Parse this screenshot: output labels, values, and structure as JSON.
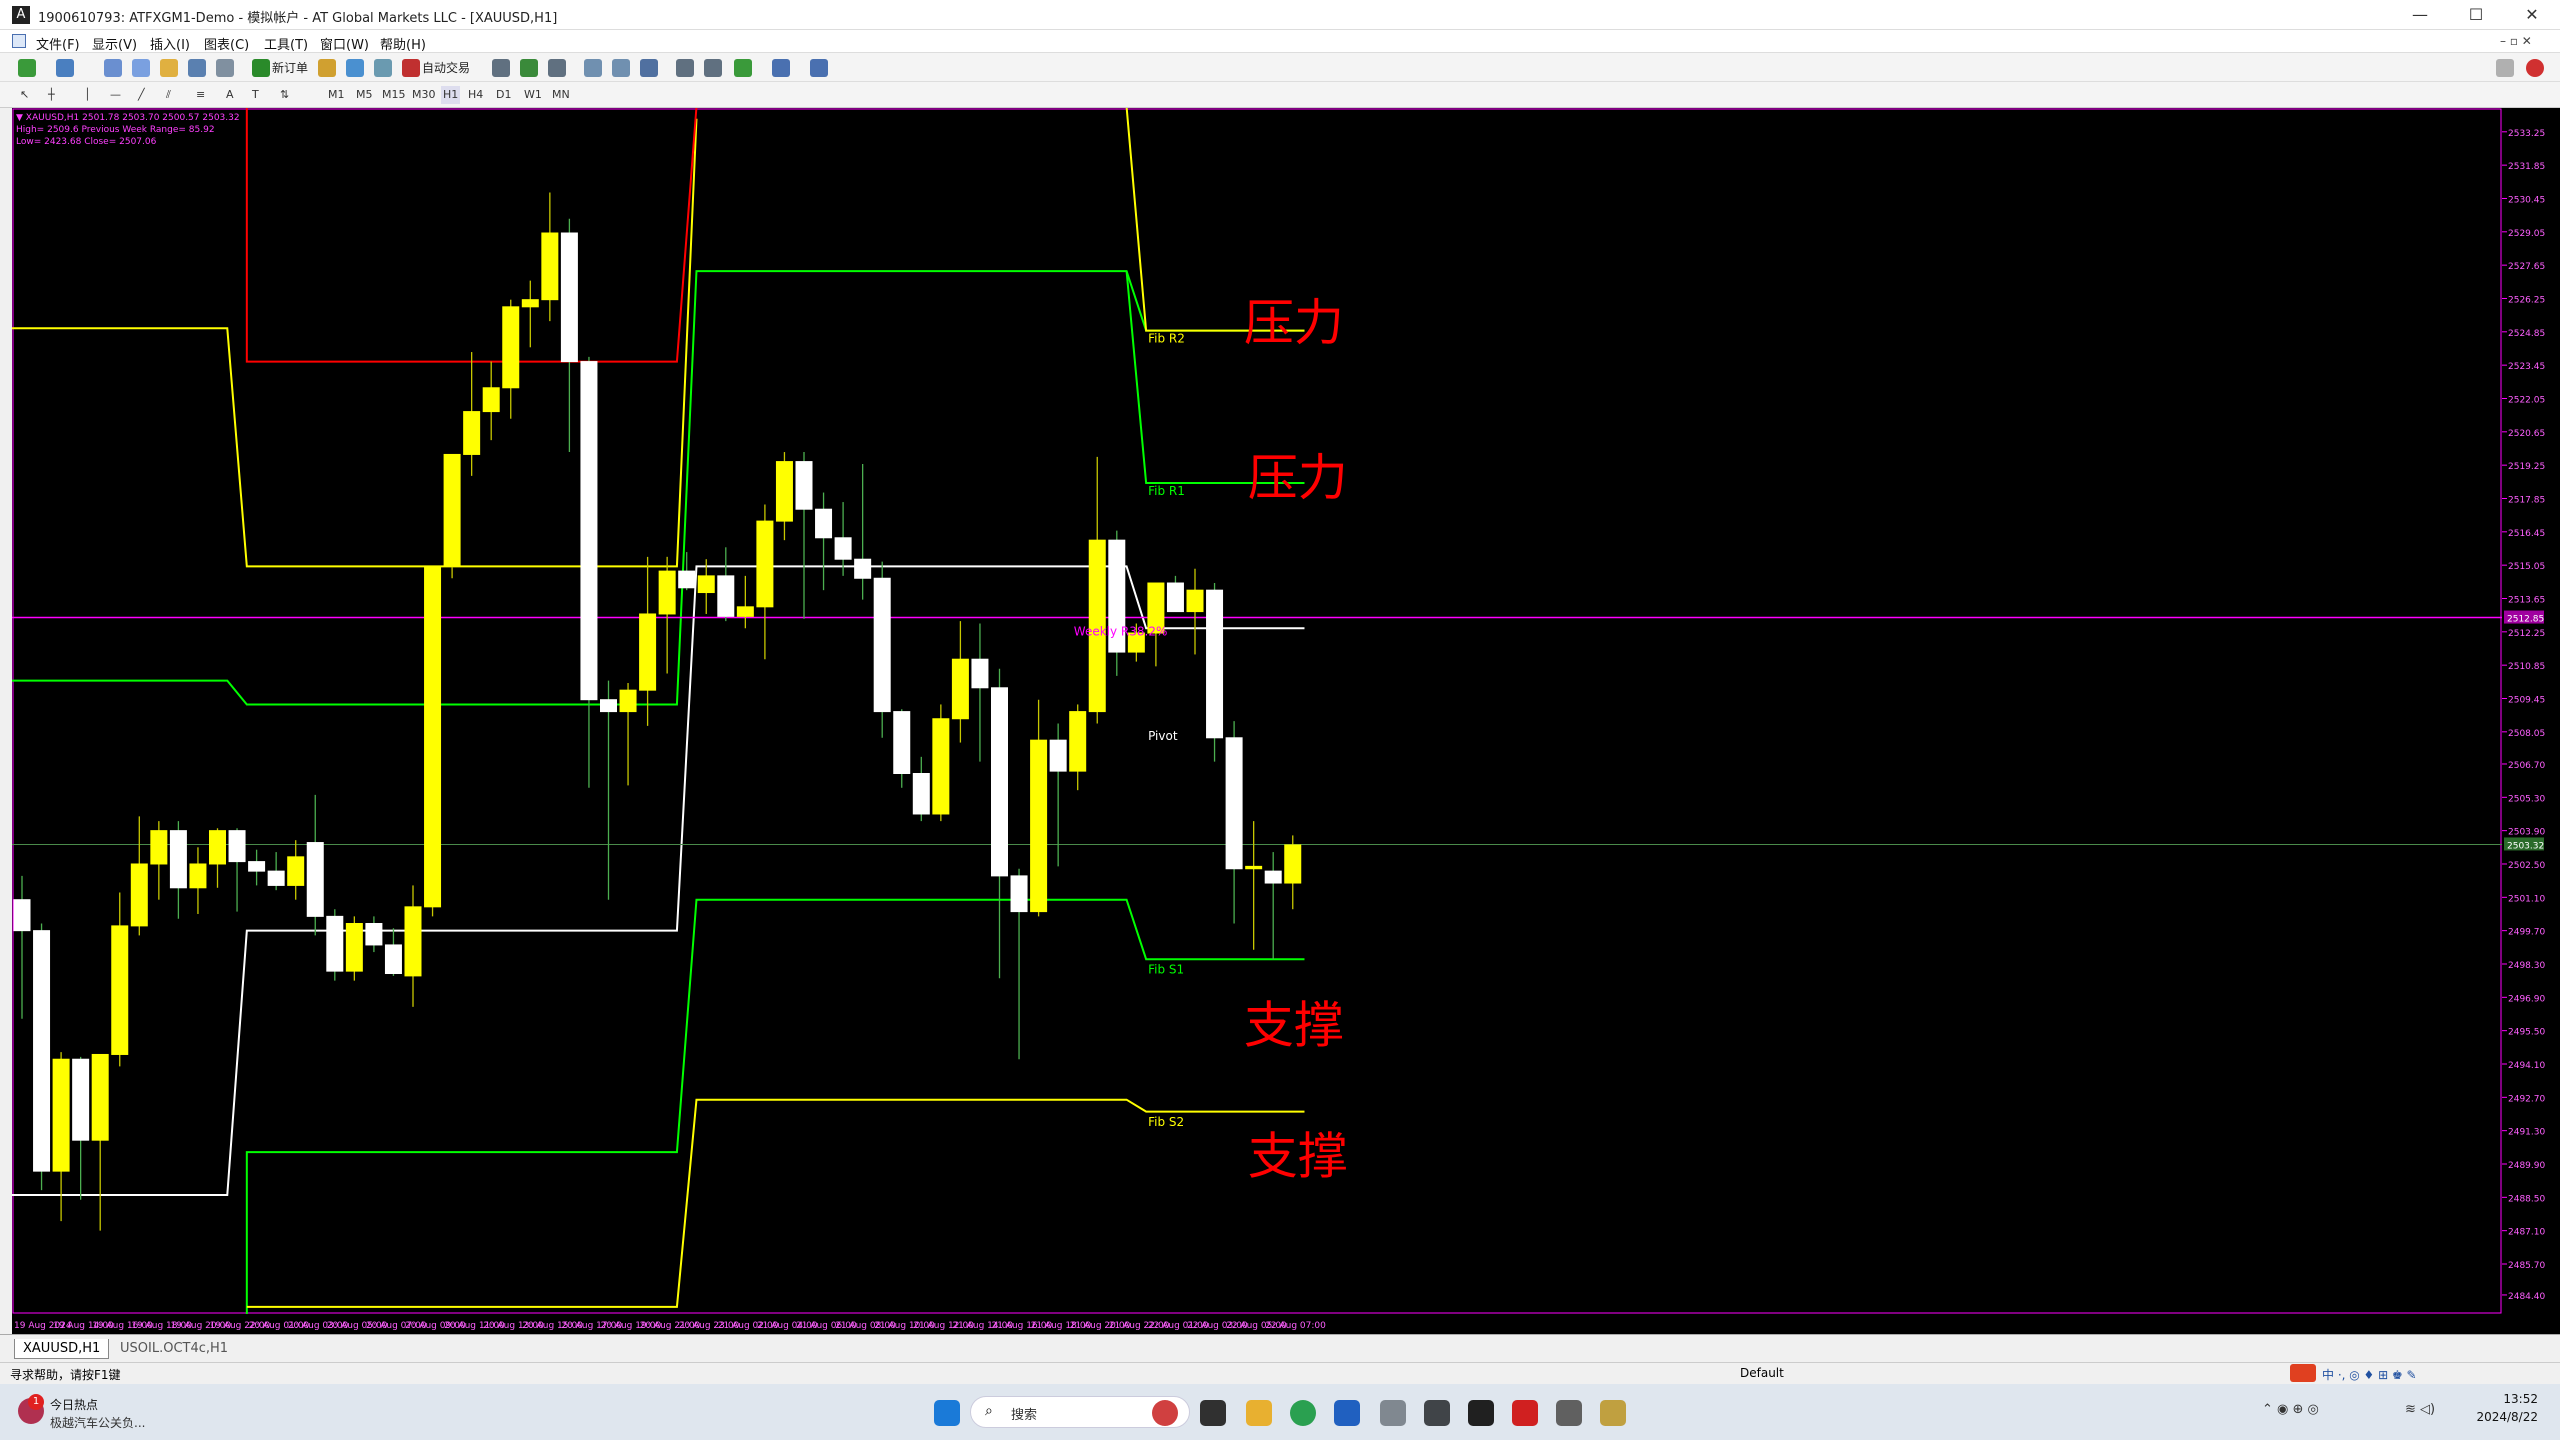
{
  "window": {
    "title": "1900610793: ATFXGM1-Demo - 模拟帐户 - AT Global Markets LLC - [XAUUSD,H1]",
    "app_icon": "A"
  },
  "menu": [
    "文件(F)",
    "显示(V)",
    "插入(I)",
    "图表(C)",
    "工具(T)",
    "窗口(W)",
    "帮助(H)"
  ],
  "toolbar": {
    "new_order": "新订单",
    "auto_trade": "自动交易"
  },
  "timeframes": [
    "M1",
    "M5",
    "M15",
    "M30",
    "H1",
    "H4",
    "D1",
    "W1",
    "MN"
  ],
  "chart": {
    "info_line1": "▼ XAUUSD,H1  2501.78 2503.70 2500.57 2503.32",
    "info_line2": "High= 2509.6    Previous Week Range= 85.92",
    "info_line3": "Low= 2423.68    Close= 2507.06",
    "current_price_label": "2503.32",
    "weekly_line_label": "2512.85",
    "annotations": [
      "压力",
      "压力",
      "支撑",
      "支撑"
    ],
    "level_labels": {
      "fib_r2": "Fib R2",
      "fib_r1": "Fib R1",
      "pivot": "Pivot",
      "fib_s1": "Fib S1",
      "fib_s2": "Fib S2",
      "weekly": "Weekly R38.2%"
    },
    "colors": {
      "bull": "#FFFF00",
      "bear": "#FFFFFF",
      "red_line": "#FF0000",
      "yellow_line": "#FFFF00",
      "green_line": "#00FF00",
      "pivot_line": "#FFFFFF",
      "magenta": "#FF00FF",
      "annotation": "#FF0000"
    }
  },
  "chart_data": {
    "type": "candlestick",
    "symbol": "XAUUSD",
    "timeframe": "H1",
    "y_ticks": [
      "2533.25",
      "2531.85",
      "2530.45",
      "2529.05",
      "2527.65",
      "2526.25",
      "2524.85",
      "2523.45",
      "2522.05",
      "2520.65",
      "2519.25",
      "2517.85",
      "2516.45",
      "2515.05",
      "2513.65",
      "2512.25",
      "2510.85",
      "2509.45",
      "2508.05",
      "2506.70",
      "2505.30",
      "2503.90",
      "2502.50",
      "2501.10",
      "2499.70",
      "2498.30",
      "2496.90",
      "2495.50",
      "2494.10",
      "2492.70",
      "2491.30",
      "2489.90",
      "2488.50",
      "2487.10",
      "2485.70",
      "2484.40"
    ],
    "x_ticks": [
      "19 Aug 2024",
      "19 Aug 14:00",
      "19 Aug 16:00",
      "19 Aug 18:00",
      "19 Aug 20:00",
      "19 Aug 22:00",
      "20 Aug 01:00",
      "20 Aug 03:00",
      "20 Aug 05:00",
      "20 Aug 07:00",
      "20 Aug 09:00",
      "20 Aug 11:00",
      "20 Aug 13:00",
      "20 Aug 15:00",
      "20 Aug 17:00",
      "20 Aug 19:00",
      "20 Aug 21:00",
      "20 Aug 23:00",
      "21 Aug 02:00",
      "21 Aug 04:00",
      "21 Aug 06:00",
      "21 Aug 08:00",
      "21 Aug 10:00",
      "21 Aug 12:00",
      "21 Aug 14:00",
      "21 Aug 16:00",
      "21 Aug 18:00",
      "21 Aug 20:00",
      "21 Aug 22:00",
      "22 Aug 01:00",
      "22 Aug 03:00",
      "22 Aug 05:00",
      "22 Aug 07:00"
    ],
    "candles": [
      {
        "o": 2501.0,
        "h": 2502.0,
        "l": 2496.0,
        "c": 2499.7
      },
      {
        "o": 2499.7,
        "h": 2500.0,
        "l": 2488.8,
        "c": 2489.6
      },
      {
        "o": 2489.6,
        "h": 2494.6,
        "l": 2487.5,
        "c": 2494.3
      },
      {
        "o": 2494.3,
        "h": 2494.4,
        "l": 2488.4,
        "c": 2490.9
      },
      {
        "o": 2490.9,
        "h": 2494.5,
        "l": 2487.1,
        "c": 2494.5
      },
      {
        "o": 2494.5,
        "h": 2501.3,
        "l": 2494.0,
        "c": 2499.9
      },
      {
        "o": 2499.9,
        "h": 2504.5,
        "l": 2499.5,
        "c": 2502.5
      },
      {
        "o": 2502.5,
        "h": 2504.3,
        "l": 2501.0,
        "c": 2503.9
      },
      {
        "o": 2503.9,
        "h": 2504.3,
        "l": 2500.2,
        "c": 2501.5
      },
      {
        "o": 2501.5,
        "h": 2503.2,
        "l": 2500.4,
        "c": 2502.5
      },
      {
        "o": 2502.5,
        "h": 2504.0,
        "l": 2501.5,
        "c": 2503.9
      },
      {
        "o": 2503.9,
        "h": 2504.0,
        "l": 2500.5,
        "c": 2502.6
      },
      {
        "o": 2502.6,
        "h": 2503.1,
        "l": 2501.6,
        "c": 2502.2
      },
      {
        "o": 2502.2,
        "h": 2503.0,
        "l": 2501.4,
        "c": 2501.6
      },
      {
        "o": 2501.6,
        "h": 2503.5,
        "l": 2501.0,
        "c": 2502.8
      },
      {
        "o": 2503.4,
        "h": 2505.4,
        "l": 2499.5,
        "c": 2500.3
      },
      {
        "o": 2500.3,
        "h": 2500.6,
        "l": 2497.6,
        "c": 2498.0
      },
      {
        "o": 2498.0,
        "h": 2500.3,
        "l": 2497.6,
        "c": 2500.0
      },
      {
        "o": 2500.0,
        "h": 2500.3,
        "l": 2498.8,
        "c": 2499.1
      },
      {
        "o": 2499.1,
        "h": 2499.8,
        "l": 2497.8,
        "c": 2497.9
      },
      {
        "o": 2497.8,
        "h": 2501.6,
        "l": 2496.5,
        "c": 2500.7
      },
      {
        "o": 2500.7,
        "h": 2513.0,
        "l": 2500.3,
        "c": 2515.0
      },
      {
        "o": 2515.0,
        "h": 2519.5,
        "l": 2514.5,
        "c": 2519.7
      },
      {
        "o": 2519.7,
        "h": 2524.0,
        "l": 2518.8,
        "c": 2521.5
      },
      {
        "o": 2521.5,
        "h": 2523.6,
        "l": 2520.3,
        "c": 2522.5
      },
      {
        "o": 2522.5,
        "h": 2526.2,
        "l": 2521.2,
        "c": 2525.9
      },
      {
        "o": 2525.9,
        "h": 2527.0,
        "l": 2524.2,
        "c": 2526.2
      },
      {
        "o": 2526.2,
        "h": 2530.7,
        "l": 2525.3,
        "c": 2529.0
      },
      {
        "o": 2529.0,
        "h": 2529.6,
        "l": 2519.8,
        "c": 2523.6
      },
      {
        "o": 2523.6,
        "h": 2523.8,
        "l": 2505.7,
        "c": 2509.4
      },
      {
        "o": 2509.4,
        "h": 2510.2,
        "l": 2501.0,
        "c": 2508.9
      },
      {
        "o": 2508.9,
        "h": 2510.1,
        "l": 2505.8,
        "c": 2509.8
      },
      {
        "o": 2509.8,
        "h": 2515.4,
        "l": 2508.3,
        "c": 2513.0
      },
      {
        "o": 2513.0,
        "h": 2515.4,
        "l": 2510.5,
        "c": 2514.8
      },
      {
        "o": 2514.8,
        "h": 2515.6,
        "l": 2514.0,
        "c": 2514.1
      },
      {
        "o": 2513.9,
        "h": 2515.3,
        "l": 2513.0,
        "c": 2514.6
      },
      {
        "o": 2514.6,
        "h": 2515.8,
        "l": 2512.7,
        "c": 2512.9
      },
      {
        "o": 2512.9,
        "h": 2514.6,
        "l": 2512.4,
        "c": 2513.3
      },
      {
        "o": 2513.3,
        "h": 2517.6,
        "l": 2511.1,
        "c": 2516.9
      },
      {
        "o": 2516.9,
        "h": 2519.8,
        "l": 2516.1,
        "c": 2519.4
      },
      {
        "o": 2519.4,
        "h": 2519.8,
        "l": 2512.8,
        "c": 2517.4
      },
      {
        "o": 2517.4,
        "h": 2518.1,
        "l": 2514.0,
        "c": 2516.2
      },
      {
        "o": 2516.2,
        "h": 2517.7,
        "l": 2514.6,
        "c": 2515.3
      },
      {
        "o": 2515.3,
        "h": 2519.3,
        "l": 2513.6,
        "c": 2514.5
      },
      {
        "o": 2514.5,
        "h": 2515.2,
        "l": 2507.8,
        "c": 2508.9
      },
      {
        "o": 2508.9,
        "h": 2509.0,
        "l": 2505.7,
        "c": 2506.3
      },
      {
        "o": 2506.3,
        "h": 2507.0,
        "l": 2504.3,
        "c": 2504.6
      },
      {
        "o": 2504.6,
        "h": 2509.2,
        "l": 2504.3,
        "c": 2508.6
      },
      {
        "o": 2508.6,
        "h": 2512.7,
        "l": 2507.6,
        "c": 2511.1
      },
      {
        "o": 2511.1,
        "h": 2512.6,
        "l": 2506.8,
        "c": 2509.9
      },
      {
        "o": 2509.9,
        "h": 2510.7,
        "l": 2497.7,
        "c": 2502.0
      },
      {
        "o": 2502.0,
        "h": 2502.3,
        "l": 2494.3,
        "c": 2500.5
      },
      {
        "o": 2500.5,
        "h": 2509.4,
        "l": 2500.3,
        "c": 2507.7
      },
      {
        "o": 2507.7,
        "h": 2508.4,
        "l": 2502.4,
        "c": 2506.4
      },
      {
        "o": 2506.4,
        "h": 2509.2,
        "l": 2505.6,
        "c": 2508.9
      },
      {
        "o": 2508.9,
        "h": 2519.6,
        "l": 2508.4,
        "c": 2516.1
      },
      {
        "o": 2516.1,
        "h": 2516.5,
        "l": 2510.4,
        "c": 2511.4
      },
      {
        "o": 2511.4,
        "h": 2512.6,
        "l": 2511.0,
        "c": 2512.2
      },
      {
        "o": 2512.2,
        "h": 2513.9,
        "l": 2510.8,
        "c": 2514.3
      },
      {
        "o": 2514.3,
        "h": 2514.6,
        "l": 2513.2,
        "c": 2513.1
      },
      {
        "o": 2513.1,
        "h": 2514.9,
        "l": 2511.3,
        "c": 2514.0
      },
      {
        "o": 2514.0,
        "h": 2514.3,
        "l": 2506.8,
        "c": 2507.8
      },
      {
        "o": 2507.8,
        "h": 2508.5,
        "l": 2500.0,
        "c": 2502.3
      },
      {
        "o": 2502.3,
        "h": 2504.3,
        "l": 2498.9,
        "c": 2502.4
      },
      {
        "o": 2502.2,
        "h": 2503.0,
        "l": 2498.5,
        "c": 2501.7
      },
      {
        "o": 2501.7,
        "h": 2503.7,
        "l": 2500.6,
        "c": 2503.3
      }
    ],
    "levels": {
      "weekly": 2512.85,
      "current": 2503.32
    }
  },
  "tabs": [
    "XAUUSD,H1",
    "USOIL.OCT4c,H1"
  ],
  "status": {
    "help": "寻求帮助，请按F1键",
    "profile": "Default"
  },
  "taskbar": {
    "news_title": "今日热点",
    "news_sub": "极越汽车公关负...",
    "news_badge": "1",
    "search": "搜索",
    "time": "13:52",
    "date": "2024/8/22"
  }
}
